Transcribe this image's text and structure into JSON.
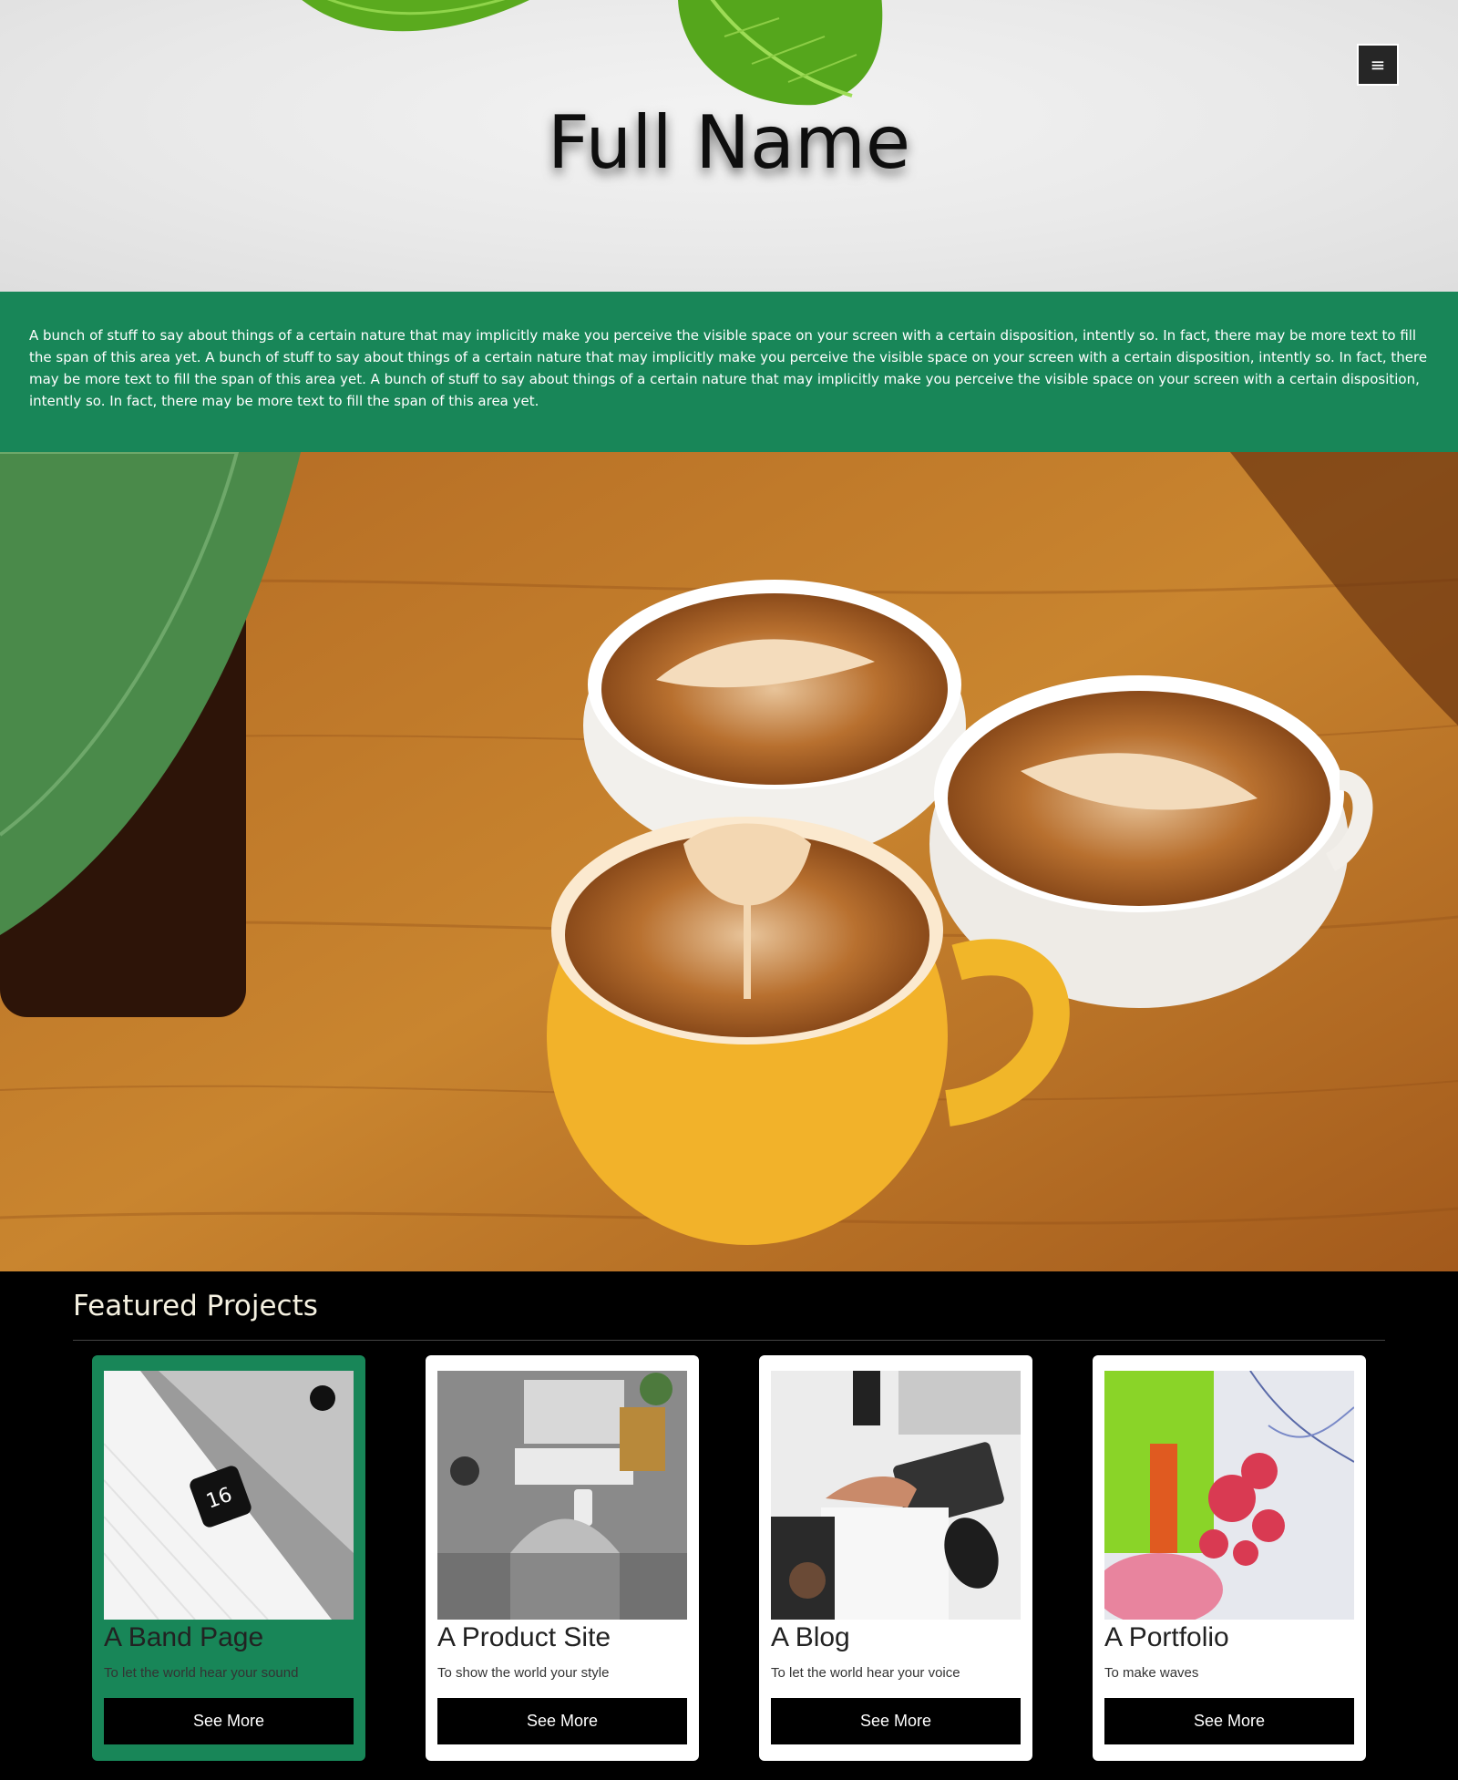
{
  "hero": {
    "title": "Full Name",
    "menu_icon": "hamburger-menu-icon"
  },
  "intro": {
    "text": "A bunch of stuff to say about things of a certain nature that may implicitly make you perceive the visible space on your screen with a certain disposition, intently so. In fact, there may be more text to fill the span of this area yet. A bunch of stuff to say about things of a certain nature that may implicitly make you perceive the visible space on your screen with a certain disposition, intently so. In fact, there may be more text to fill the span of this area yet. A bunch of stuff to say about things of a certain nature that may implicitly make you perceive the visible space on your screen with a certain disposition, intently so. In fact, there may be more text to fill the span of this area yet."
  },
  "featured": {
    "heading": "Featured Projects",
    "cards": [
      {
        "title": "A Band Page",
        "subtitle": "To let the world hear your sound",
        "button": "See More"
      },
      {
        "title": "A Product Site",
        "subtitle": "To show the world your style",
        "button": "See More"
      },
      {
        "title": "A Blog",
        "subtitle": "To let the world hear your voice",
        "button": "See More"
      },
      {
        "title": "A Portfolio",
        "subtitle": "To make waves",
        "button": "See More"
      }
    ]
  },
  "colors": {
    "accent_green": "#188658",
    "background": "#000000",
    "button": "#000000"
  }
}
